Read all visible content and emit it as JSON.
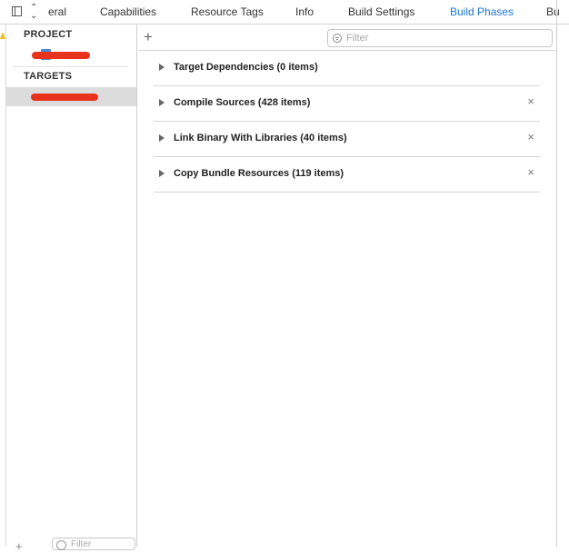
{
  "tabs": [
    {
      "label": "eral",
      "active": false
    },
    {
      "label": "Capabilities",
      "active": false
    },
    {
      "label": "Resource Tags",
      "active": false
    },
    {
      "label": "Info",
      "active": false
    },
    {
      "label": "Build Settings",
      "active": false
    },
    {
      "label": "Build Phases",
      "active": true
    },
    {
      "label": "Bu",
      "active": false
    }
  ],
  "sidebar": {
    "project_header": "PROJECT",
    "targets_header": "TARGETS",
    "filter_placeholder": "Filter"
  },
  "toolbar": {
    "add_label": "+",
    "filter_placeholder": "Filter"
  },
  "phases": [
    {
      "title": "Target Dependencies (0 items)",
      "removable": false
    },
    {
      "title": "Compile Sources (428 items)",
      "removable": true
    },
    {
      "title": "Link Binary With Libraries (40 items)",
      "removable": true
    },
    {
      "title": "Copy Bundle Resources (119 items)",
      "removable": true
    }
  ],
  "colors": {
    "accent": "#1a76d2",
    "selection": "#dcdcdc",
    "redaction": "#e8321c"
  },
  "icons": {
    "close": "×",
    "add": "+"
  }
}
